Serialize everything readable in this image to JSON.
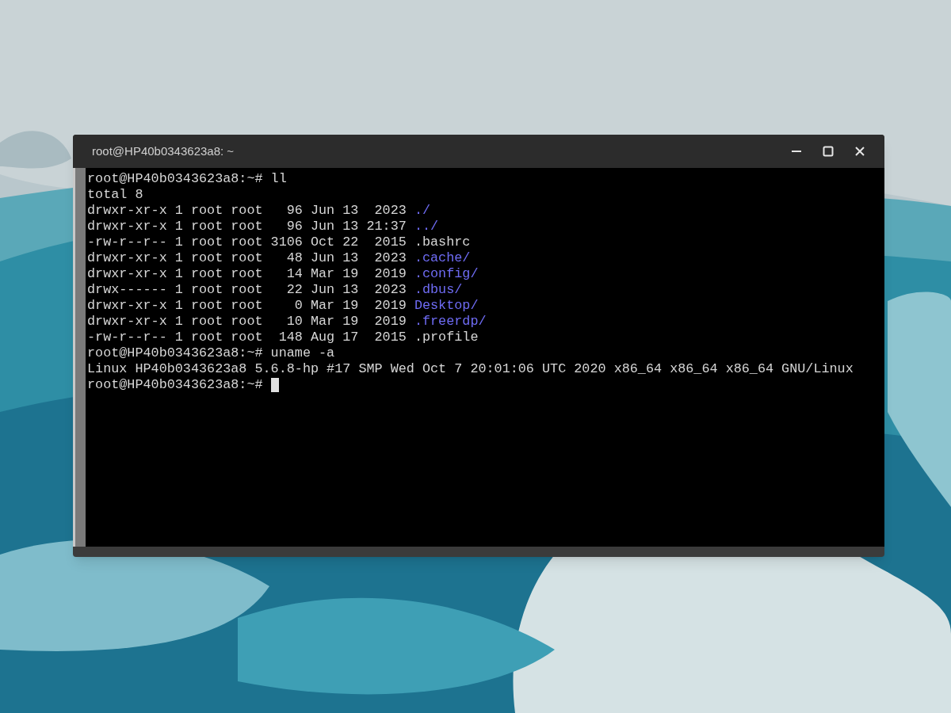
{
  "window": {
    "title": "root@HP40b0343623a8: ~"
  },
  "terminal": {
    "lines": [
      {
        "text": "root@HP40b0343623a8:~# ll"
      },
      {
        "text": "total 8"
      },
      {
        "text": "drwxr-xr-x 1 root root   96 Jun 13  2023 ",
        "name": "./",
        "kind": "dir"
      },
      {
        "text": "drwxr-xr-x 1 root root   96 Jun 13 21:37 ",
        "name": "../",
        "kind": "dir"
      },
      {
        "text": "-rw-r--r-- 1 root root 3106 Oct 22  2015 ",
        "name": ".bashrc",
        "kind": "file"
      },
      {
        "text": "drwxr-xr-x 1 root root   48 Jun 13  2023 ",
        "name": ".cache/",
        "kind": "dir"
      },
      {
        "text": "drwxr-xr-x 1 root root   14 Mar 19  2019 ",
        "name": ".config/",
        "kind": "dir"
      },
      {
        "text": "drwx------ 1 root root   22 Jun 13  2023 ",
        "name": ".dbus/",
        "kind": "dir"
      },
      {
        "text": "drwxr-xr-x 1 root root    0 Mar 19  2019 ",
        "name": "Desktop/",
        "kind": "dir"
      },
      {
        "text": "drwxr-xr-x 1 root root   10 Mar 19  2019 ",
        "name": ".freerdp/",
        "kind": "dir"
      },
      {
        "text": "-rw-r--r-- 1 root root  148 Aug 17  2015 ",
        "name": ".profile",
        "kind": "file"
      },
      {
        "text": "root@HP40b0343623a8:~# uname -a"
      },
      {
        "text": "Linux HP40b0343623a8 5.6.8-hp #17 SMP Wed Oct 7 20:01:06 UTC 2020 x86_64 x86_64 x86_64 GNU/Linux"
      },
      {
        "text": "root@HP40b0343623a8:~# ",
        "cursor": true
      }
    ]
  }
}
